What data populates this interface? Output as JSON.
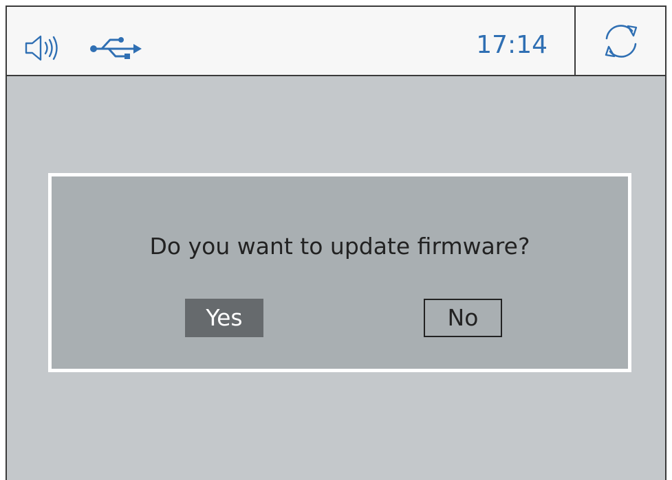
{
  "status_bar": {
    "sound_icon": "speaker-volume-icon",
    "usb_icon": "usb-icon",
    "time": "17:14",
    "refresh_icon": "refresh-icon"
  },
  "dialog": {
    "message": "Do you want to update firmware?",
    "yes_label": "Yes",
    "no_label": "No"
  },
  "colors": {
    "accent_blue": "#2f6fb3",
    "screen_bg": "#c4c8cb",
    "dialog_bg": "#a9afb2",
    "selected_button_bg": "#666a6d",
    "status_bar_bg": "#f7f7f7"
  }
}
